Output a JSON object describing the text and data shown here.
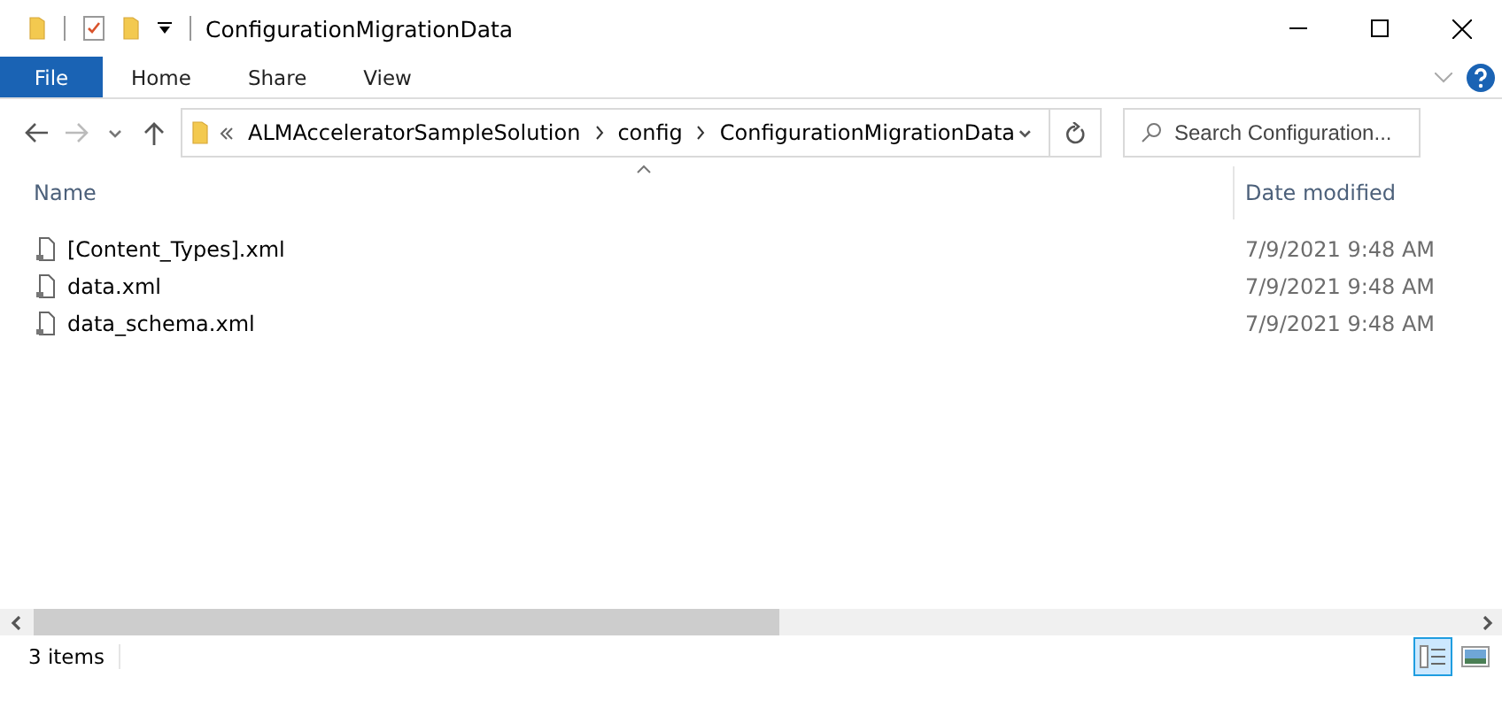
{
  "window": {
    "title": "ConfigurationMigrationData"
  },
  "ribbon_tabs": [
    {
      "label": "File",
      "selected": true
    },
    {
      "label": "Home",
      "selected": false
    },
    {
      "label": "Share",
      "selected": false
    },
    {
      "label": "View",
      "selected": false
    }
  ],
  "address": {
    "breadcrumbs": [
      "ALMAcceleratorSampleSolution",
      "config",
      "ConfigurationMigrationData"
    ]
  },
  "search": {
    "placeholder": "Search Configuration..."
  },
  "table": {
    "columns": [
      "Name",
      "Date modified"
    ],
    "rows": [
      {
        "name": "[Content_Types].xml",
        "date": "7/9/2021 9:48 AM"
      },
      {
        "name": "data.xml",
        "date": "7/9/2021 9:48 AM"
      },
      {
        "name": "data_schema.xml",
        "date": "7/9/2021 9:48 AM"
      }
    ]
  },
  "status_bar": {
    "count": "3 items",
    "views": [
      {
        "kind": "details",
        "selected": true
      },
      {
        "kind": "large",
        "selected": false
      }
    ]
  }
}
